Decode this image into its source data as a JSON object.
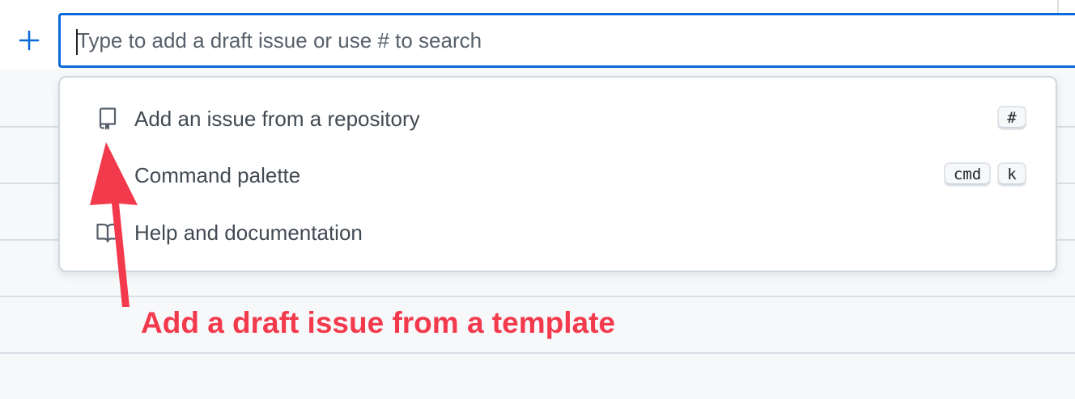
{
  "new_item": {
    "add_icon": "plus-icon",
    "input_placeholder": "Type to add a draft issue or use # to search",
    "input_value": ""
  },
  "menu": {
    "items": [
      {
        "label": "Add an issue from a repository",
        "icon": "repo-icon",
        "shortcut": [
          "#"
        ]
      },
      {
        "label": "Command palette",
        "icon": "command-palette-icon",
        "shortcut": [
          "cmd",
          "k"
        ]
      },
      {
        "label": "Help and documentation",
        "icon": "book-icon",
        "shortcut": []
      }
    ]
  },
  "annotation": {
    "text": "Add a draft issue from a template",
    "color": "#f23a4c"
  },
  "colors": {
    "accent": "#0969da",
    "background": "#f6f8fa"
  }
}
